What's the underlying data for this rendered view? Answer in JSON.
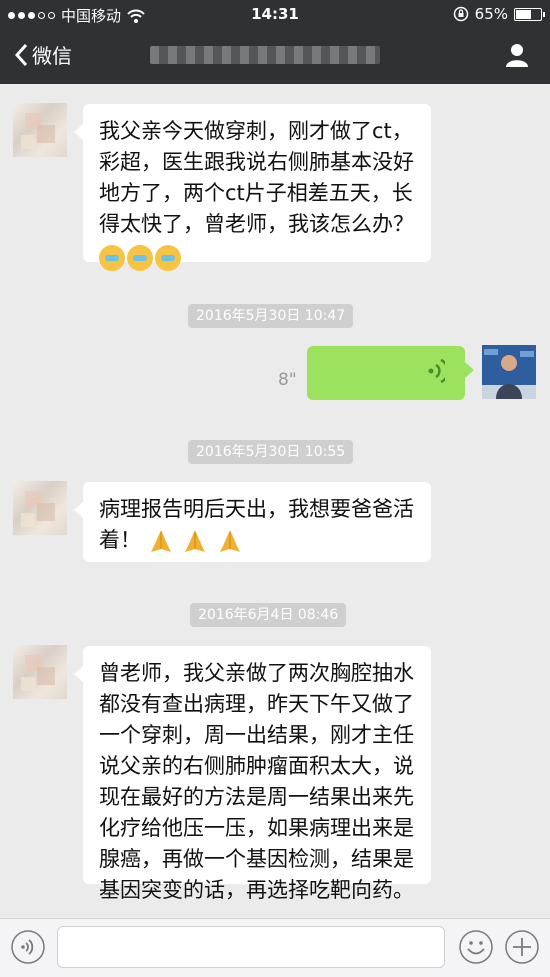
{
  "status_bar": {
    "carrier": "中国移动",
    "time": "14:31",
    "battery": "65%"
  },
  "nav": {
    "back_label": "微信"
  },
  "messages": {
    "m1_line1": "我父亲今天做穿刺，刚才做了ct，",
    "m1_line2": "彩超，医生跟我说右侧肺基本没好",
    "m1_line3": "地方了，两个ct片子相差五天，长",
    "m1_line4": "得太快了，曾老师，我该怎么办？",
    "ts1": "2016年5月30日 10:47",
    "voice_duration": "8\"",
    "ts2": "2016年5月30日 10:55",
    "m2_line1": "病理报告明后天出，我想要爸爸活",
    "m2_line2": "着！",
    "ts3": "2016年6月4日 08:46",
    "m3_line1": "曾老师，我父亲做了两次胸腔抽水",
    "m3_line2": "都没有查出病理，昨天下午又做了",
    "m3_line3": "一个穿刺，周一出结果，刚才主任",
    "m3_line4": "说父亲的右侧肺肿瘤面积太大，说",
    "m3_line5": "现在最好的方法是周一结果出来先",
    "m3_line6": "化疗给他压一压，如果病理出来是",
    "m3_line7": "腺癌，再做一个基因检测，结果是",
    "m3_line8": "基因突变的话，再选择吃靶向药。"
  },
  "icons": {
    "signal": "signal-dots-icon",
    "wifi": "wifi-icon",
    "lock": "orientation-lock-icon",
    "battery": "battery-icon",
    "back": "chevron-left-icon",
    "profile": "person-icon",
    "voice": "voice-wave-icon",
    "voice_input": "voice-input-icon",
    "emoji": "emoji-icon",
    "plus": "plus-icon"
  },
  "colors": {
    "bar": "#2f3135",
    "background": "#ebebeb",
    "my_bubble": "#9be35f",
    "other_bubble": "#ffffff",
    "timestamp": "#cfcfcf"
  }
}
